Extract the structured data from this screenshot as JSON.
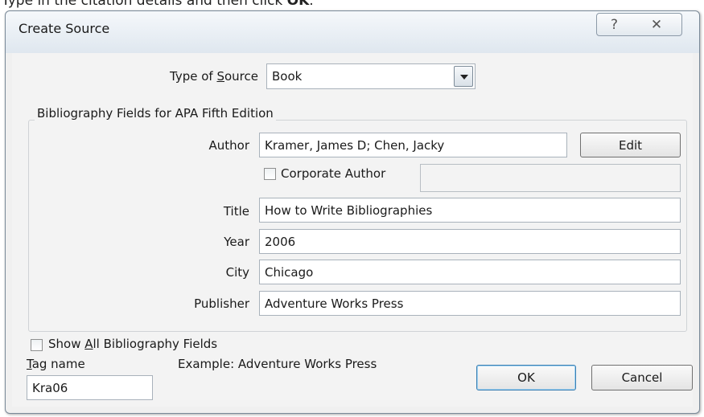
{
  "instruction": {
    "prefix": "Type in the citation details and then click ",
    "bold": "OK",
    "suffix": "."
  },
  "dialog": {
    "title": "Create Source",
    "help_glyph": "?",
    "close_glyph": "✕",
    "type_of_source": {
      "label_pre": "Type of ",
      "label_accel": "S",
      "label_post": "ource",
      "value": "Book"
    },
    "group_label": "Bibliography Fields for APA Fifth Edition",
    "fields": {
      "author": {
        "label": "Author",
        "value": "Kramer, James D; Chen, Jacky"
      },
      "corporate_author": {
        "label": "Corporate Author",
        "value": "",
        "checked": false
      },
      "title": {
        "label": "Title",
        "value": "How to Write Bibliographies"
      },
      "year": {
        "label": "Year",
        "value": "2006"
      },
      "city": {
        "label": "City",
        "value": "Chicago"
      },
      "publisher": {
        "label": "Publisher",
        "value": "Adventure Works Press"
      }
    },
    "edit_button": "Edit",
    "show_all": {
      "label_pre": "Show ",
      "label_accel": "A",
      "label_post": "ll Bibliography Fields",
      "checked": false
    },
    "tag": {
      "label_accel": "T",
      "label_post": "ag name",
      "value": "Kra06"
    },
    "example": "Example: Adventure Works Press",
    "ok_button": "OK",
    "cancel_button": "Cancel"
  }
}
